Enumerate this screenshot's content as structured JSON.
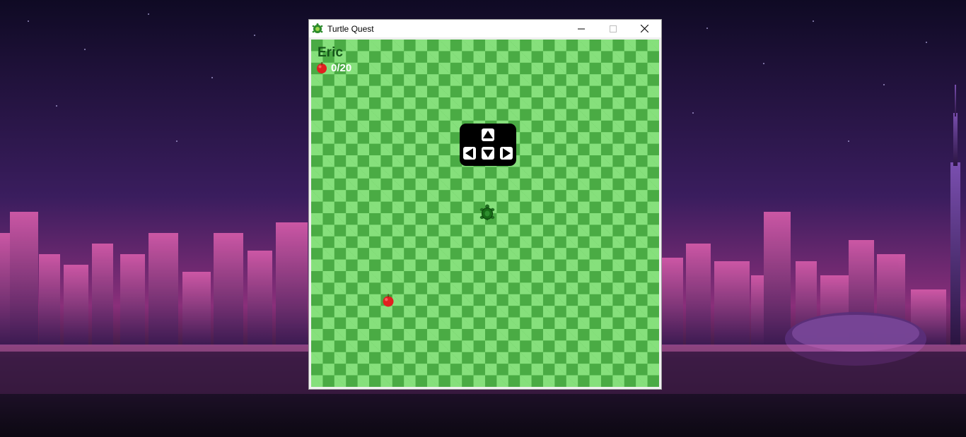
{
  "window": {
    "title": "Turtle Quest",
    "controls": {
      "minimize": "minimize",
      "maximize": "maximize",
      "close": "close"
    }
  },
  "game": {
    "player_name": "Eric",
    "score": "0/20",
    "controls_hint": [
      "arrow-up",
      "arrow-left",
      "arrow-down",
      "arrow-right"
    ]
  },
  "colors": {
    "grass_dark": "#4aab44",
    "grass_light": "#86e07c",
    "player_name": "#15561a",
    "score_text": "#ffffff",
    "apple": "#e02020"
  },
  "icons": {
    "app": "turtle-icon",
    "score": "apple-icon",
    "player": "turtle-icon",
    "collectible": "apple-icon"
  }
}
